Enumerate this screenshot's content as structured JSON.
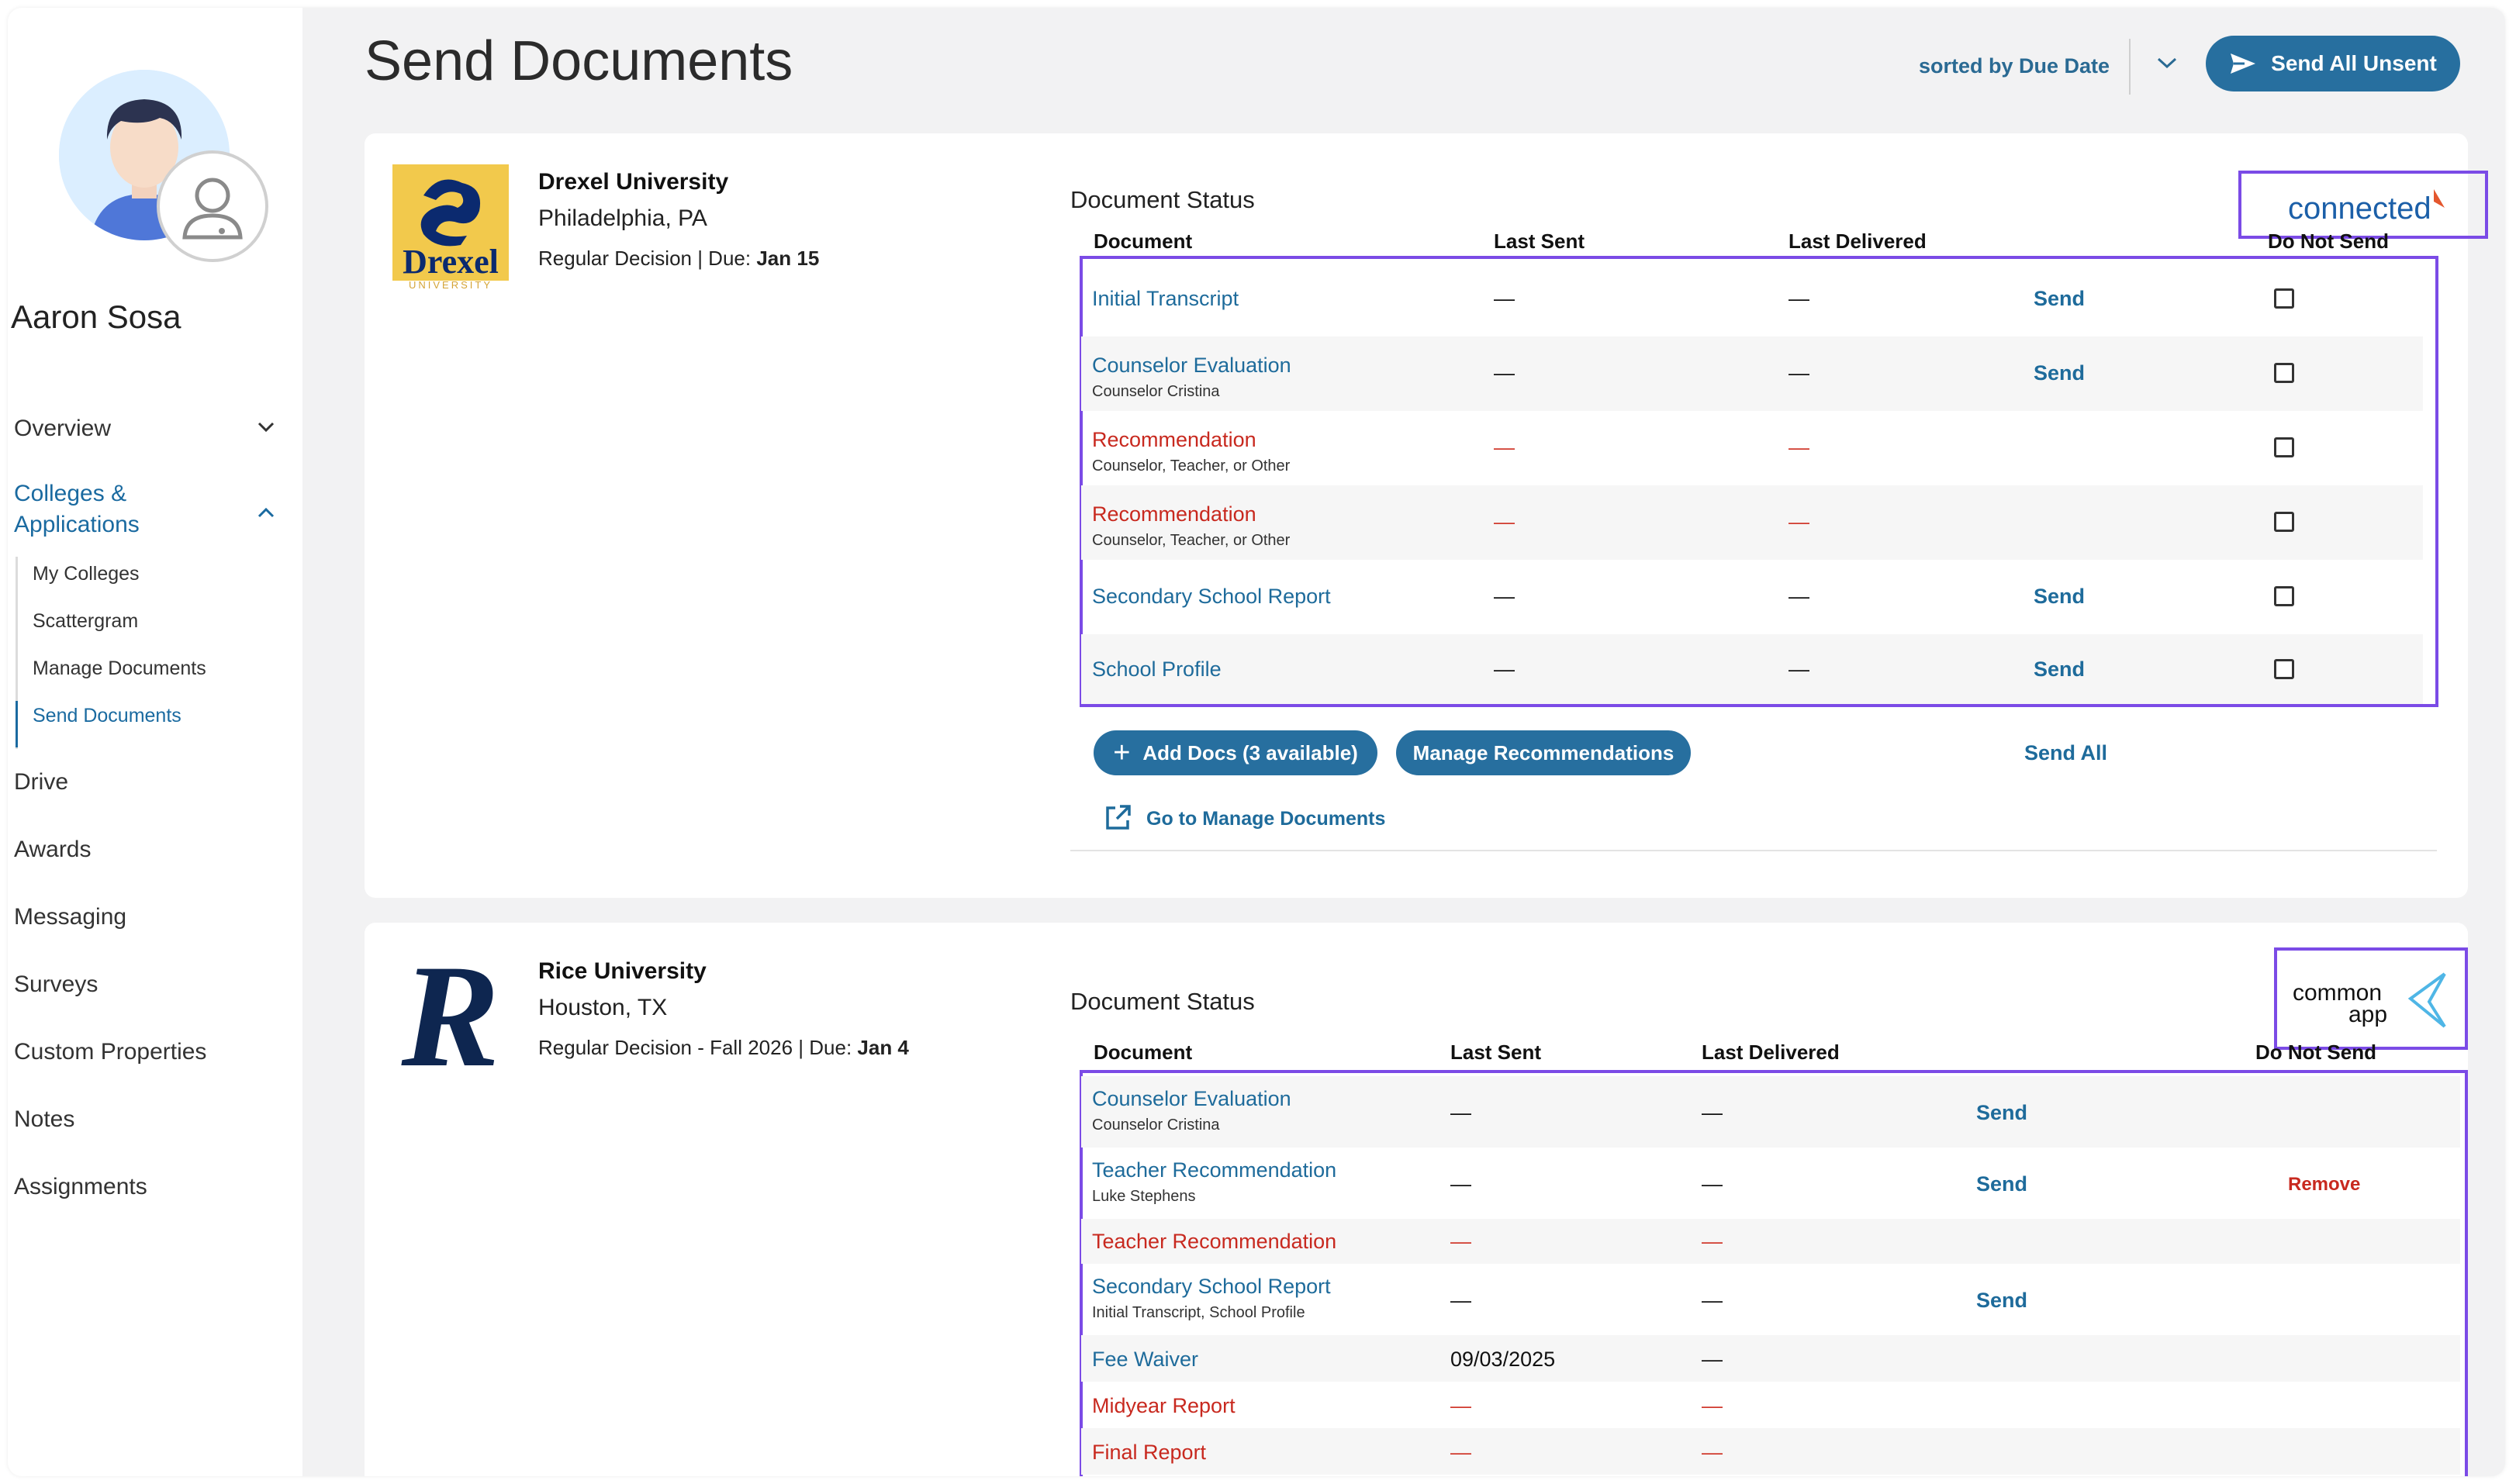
{
  "student": {
    "name": "Aaron Sosa"
  },
  "nav": {
    "overview": "Overview",
    "colleges": "Colleges &",
    "colleges_line2": "Applications",
    "sub": [
      "My Colleges",
      "Scattergram",
      "Manage Documents",
      "Send Documents"
    ],
    "drive": "Drive",
    "awards": "Awards",
    "messaging": "Messaging",
    "surveys": "Surveys",
    "custom_properties": "Custom Properties",
    "notes": "Notes",
    "assignments": "Assignments"
  },
  "header": {
    "title": "Send Documents",
    "sort_label": "sorted by Due Date",
    "send_all_unsent": "Send All Unsent"
  },
  "columns": {
    "document": "Document",
    "last_sent": "Last Sent",
    "last_delivered": "Last Delivered",
    "do_not_send": "Do Not Send",
    "doc_status": "Document Status"
  },
  "drexel": {
    "name": "Drexel University",
    "location": "Philadelphia, PA",
    "plan": "Regular Decision | Due: ",
    "due": "Jan 15",
    "logo_text": "Drexel",
    "logo_sub": "UNIVERSITY",
    "platform": "connected",
    "rows": [
      {
        "doc": "Initial Transcript",
        "sub": "",
        "sent": "—",
        "delivered": "—",
        "action": "Send"
      },
      {
        "doc": "Counselor Evaluation",
        "sub": "Counselor Cristina",
        "sent": "—",
        "delivered": "—",
        "action": "Send"
      },
      {
        "doc": "Recommendation",
        "sub": "Counselor, Teacher, or Other",
        "sent": "—",
        "delivered": "—",
        "action": ""
      },
      {
        "doc": "Recommendation",
        "sub": "Counselor, Teacher, or Other",
        "sent": "—",
        "delivered": "—",
        "action": ""
      },
      {
        "doc": "Secondary School Report",
        "sub": "",
        "sent": "—",
        "delivered": "—",
        "action": "Send"
      },
      {
        "doc": "School Profile",
        "sub": "",
        "sent": "—",
        "delivered": "—",
        "action": "Send"
      }
    ],
    "add_docs": "Add Docs (3 available)",
    "manage_recs": "Manage Recommendations",
    "send_all": "Send All",
    "goto_manage": "Go to Manage Documents"
  },
  "rice": {
    "name": "Rice University",
    "location": "Houston, TX",
    "plan": "Regular Decision - Fall 2026 | Due: ",
    "due": "Jan 4",
    "logo_text": "R",
    "platform_line1": "common",
    "platform_line2": "app",
    "rows": [
      {
        "doc": "Counselor Evaluation",
        "sub": "Counselor Cristina",
        "sent": "—",
        "delivered": "—",
        "action": "Send",
        "extra": ""
      },
      {
        "doc": "Teacher Recommendation",
        "sub": "Luke Stephens",
        "sent": "—",
        "delivered": "—",
        "action": "Send",
        "extra": "Remove"
      },
      {
        "doc": "Teacher Recommendation",
        "sub": "",
        "sent": "—",
        "delivered": "—",
        "action": "",
        "extra": ""
      },
      {
        "doc": "Secondary School Report",
        "sub": "Initial Transcript, School Profile",
        "sent": "—",
        "delivered": "—",
        "action": "Send",
        "extra": ""
      },
      {
        "doc": "Fee Waiver",
        "sub": "",
        "sent": "09/03/2025",
        "delivered": "—",
        "action": "",
        "extra": ""
      },
      {
        "doc": "Midyear Report",
        "sub": "",
        "sent": "—",
        "delivered": "—",
        "action": "",
        "extra": ""
      },
      {
        "doc": "Final Report",
        "sub": "",
        "sent": "—",
        "delivered": "—",
        "action": "",
        "extra": ""
      }
    ]
  },
  "colors": {
    "accent": "#276f9f",
    "link": "#1e6b9b",
    "warning": "#c8291f",
    "highlight": "#7b4be6"
  }
}
